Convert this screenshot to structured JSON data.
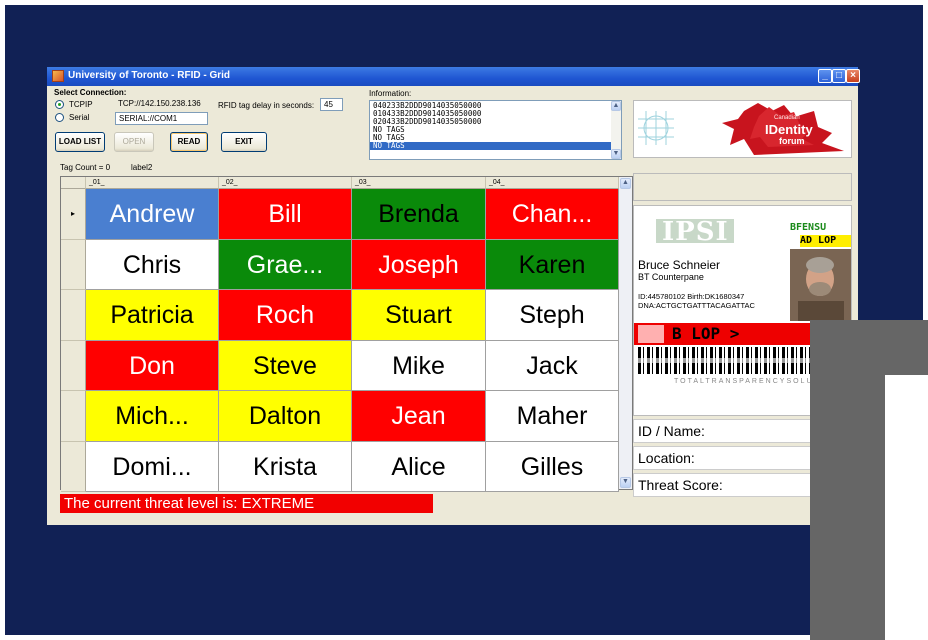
{
  "window": {
    "title": "University of Toronto - RFID - Grid",
    "buttons": [
      "_",
      "□",
      "×"
    ]
  },
  "connection": {
    "group_label": "Select Connection:",
    "tcpip_label": "TCPIP",
    "serial_label": "Serial",
    "tcpip_value": "TCP://142.150.238.136",
    "serial_value": "SERIAL://COM1",
    "delay_label": "RFID tag delay in seconds:",
    "delay_value": "45"
  },
  "buttons": {
    "load_list": "LOAD LIST",
    "open": "OPEN",
    "read": "READ",
    "exit": "EXIT"
  },
  "tag_count": "Tag Count = 0",
  "label2": "label2",
  "information": {
    "label": "Information:",
    "items": [
      "040233B2DDD9014035050000",
      "010433B2DDD9014035050000",
      "020433B2DDD9014035050000",
      "NO TAGS",
      "NO TAGS",
      "NO TAGS"
    ]
  },
  "banner": {
    "line1": "Canadian",
    "line2": "IDentity",
    "line3": "forum"
  },
  "grid": {
    "columns": [
      "_01_",
      "_02_",
      "_03_",
      "_04_"
    ],
    "rows": [
      [
        {
          "t": "Andrew",
          "c": "#4a7fd0",
          "f": "#ffffff"
        },
        {
          "t": "Bill",
          "c": "#ff0000",
          "f": "#ffffff"
        },
        {
          "t": "Brenda",
          "c": "#0a8a0a",
          "f": "#000000"
        },
        {
          "t": "Chan...",
          "c": "#ff0000",
          "f": "#ffffff"
        }
      ],
      [
        {
          "t": "Chris",
          "c": "#ffffff",
          "f": "#000000"
        },
        {
          "t": "Grae...",
          "c": "#0a8a0a",
          "f": "#ffffff"
        },
        {
          "t": "Joseph",
          "c": "#ff0000",
          "f": "#ffffff"
        },
        {
          "t": "Karen",
          "c": "#0a8a0a",
          "f": "#000000"
        }
      ],
      [
        {
          "t": "Patricia",
          "c": "#ffff00",
          "f": "#000000"
        },
        {
          "t": "Roch",
          "c": "#ff0000",
          "f": "#ffffff"
        },
        {
          "t": "Stuart",
          "c": "#ffff00",
          "f": "#000000"
        },
        {
          "t": "Steph",
          "c": "#ffffff",
          "f": "#000000"
        }
      ],
      [
        {
          "t": "Don",
          "c": "#ff0000",
          "f": "#ffffff"
        },
        {
          "t": "Steve",
          "c": "#ffff00",
          "f": "#000000"
        },
        {
          "t": "Mike",
          "c": "#ffffff",
          "f": "#000000"
        },
        {
          "t": "Jack",
          "c": "#ffffff",
          "f": "#000000"
        }
      ],
      [
        {
          "t": "Mich...",
          "c": "#ffff00",
          "f": "#000000"
        },
        {
          "t": "Dalton",
          "c": "#ffff00",
          "f": "#000000"
        },
        {
          "t": "Jean",
          "c": "#ff0000",
          "f": "#ffffff"
        },
        {
          "t": "Maher",
          "c": "#ffffff",
          "f": "#000000"
        }
      ],
      [
        {
          "t": "Domi...",
          "c": "#ffffff",
          "f": "#000000"
        },
        {
          "t": "Krista",
          "c": "#ffffff",
          "f": "#000000"
        },
        {
          "t": "Alice",
          "c": "#ffffff",
          "f": "#000000"
        },
        {
          "t": "Gilles",
          "c": "#ffffff",
          "f": "#000000"
        }
      ]
    ],
    "current_row_marker": "▸"
  },
  "threat_status": "The current threat level is: EXTREME",
  "id_card": {
    "org": "IPSI",
    "badge_top": "BFENSU",
    "badge_bottom": "AD LOP",
    "name": "Bruce Schneier",
    "company": "BT Counterpane",
    "id_line": "ID:445780102 Birth:DK1680347",
    "dna_line": "DNA:ACTGCTGATTTACAGATTAC",
    "stripe_text": "B    LOP  >",
    "footer": "TOTALTRANSPARENCYSOLUT"
  },
  "fields": {
    "id_name": "ID / Name:",
    "location": "Location:",
    "threat_score": "Threat Score:"
  },
  "colors": {
    "desktop": "#112155",
    "threat_red": "#f20000",
    "xp_face": "#ece9d8"
  }
}
